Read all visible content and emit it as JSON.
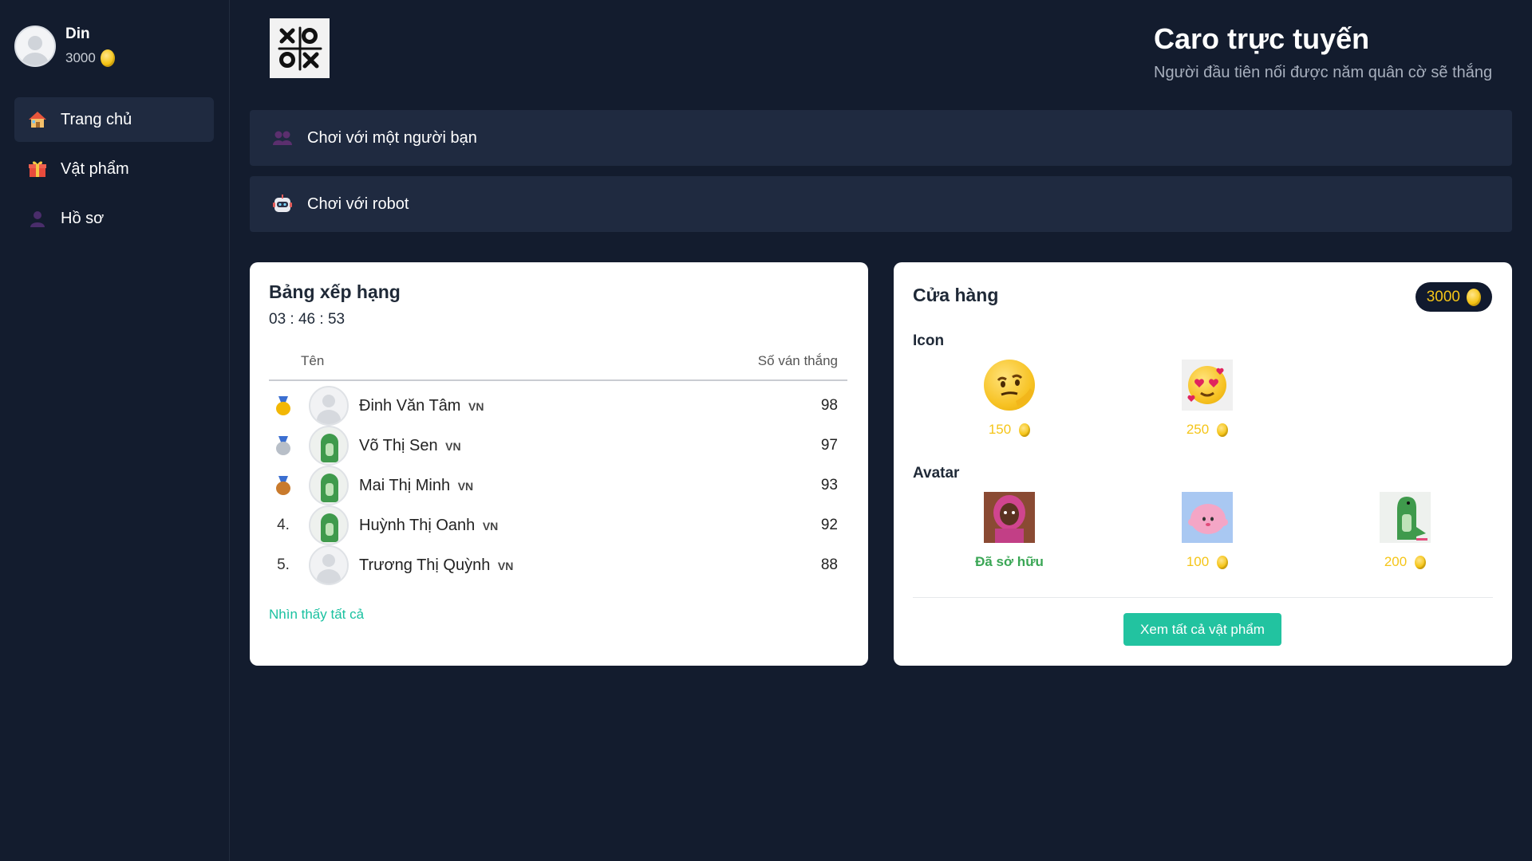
{
  "user": {
    "name": "Din",
    "coins": "3000"
  },
  "sidebar": {
    "items": [
      {
        "label": "Trang chủ",
        "icon": "home-icon"
      },
      {
        "label": "Vật phẩm",
        "icon": "gift-icon"
      },
      {
        "label": "Hồ sơ",
        "icon": "profile-icon"
      }
    ]
  },
  "header": {
    "title": "Caro trực tuyến",
    "subtitle": "Người đầu tiên nối được năm quân cờ sẽ thắng"
  },
  "play": {
    "friend_label": "Chơi với một người bạn",
    "robot_label": "Chơi với robot"
  },
  "leaderboard": {
    "title": "Bảng xếp hạng",
    "timer": "03 : 46 : 53",
    "col_name": "Tên",
    "col_wins": "Số ván thắng",
    "rows": [
      {
        "rank": "",
        "medal": "gold",
        "name": "Đinh Văn Tâm",
        "flag": "VN",
        "wins": "98",
        "avatar": "default"
      },
      {
        "rank": "",
        "medal": "silver",
        "name": "Võ Thị Sen",
        "flag": "VN",
        "wins": "97",
        "avatar": "dino"
      },
      {
        "rank": "",
        "medal": "bronze",
        "name": "Mai Thị Minh",
        "flag": "VN",
        "wins": "93",
        "avatar": "dino"
      },
      {
        "rank": "4.",
        "medal": "",
        "name": "Huỳnh Thị Oanh",
        "flag": "VN",
        "wins": "92",
        "avatar": "dino"
      },
      {
        "rank": "5.",
        "medal": "",
        "name": "Trương Thị Quỳnh",
        "flag": "VN",
        "wins": "88",
        "avatar": "default"
      }
    ],
    "see_all": "Nhìn thấy tất cả"
  },
  "shop": {
    "title": "Cửa hàng",
    "balance": "3000",
    "icon_section": "Icon",
    "avatar_section": "Avatar",
    "icons": [
      {
        "name": "thinking-face-emoji",
        "price": "150"
      },
      {
        "name": "heart-eyes-emoji",
        "price": "250"
      }
    ],
    "avatars": [
      {
        "name": "costume-kid-avatar",
        "status": "Đã sở hữu"
      },
      {
        "name": "pink-blob-avatar",
        "price": "100"
      },
      {
        "name": "green-dino-avatar",
        "price": "200"
      }
    ],
    "view_all_label": "Xem tất cả vật phẩm"
  },
  "colors": {
    "background": "#131c2e",
    "panel": "#1f2a40",
    "accent": "#22c3a0",
    "coin": "#f5c518"
  }
}
